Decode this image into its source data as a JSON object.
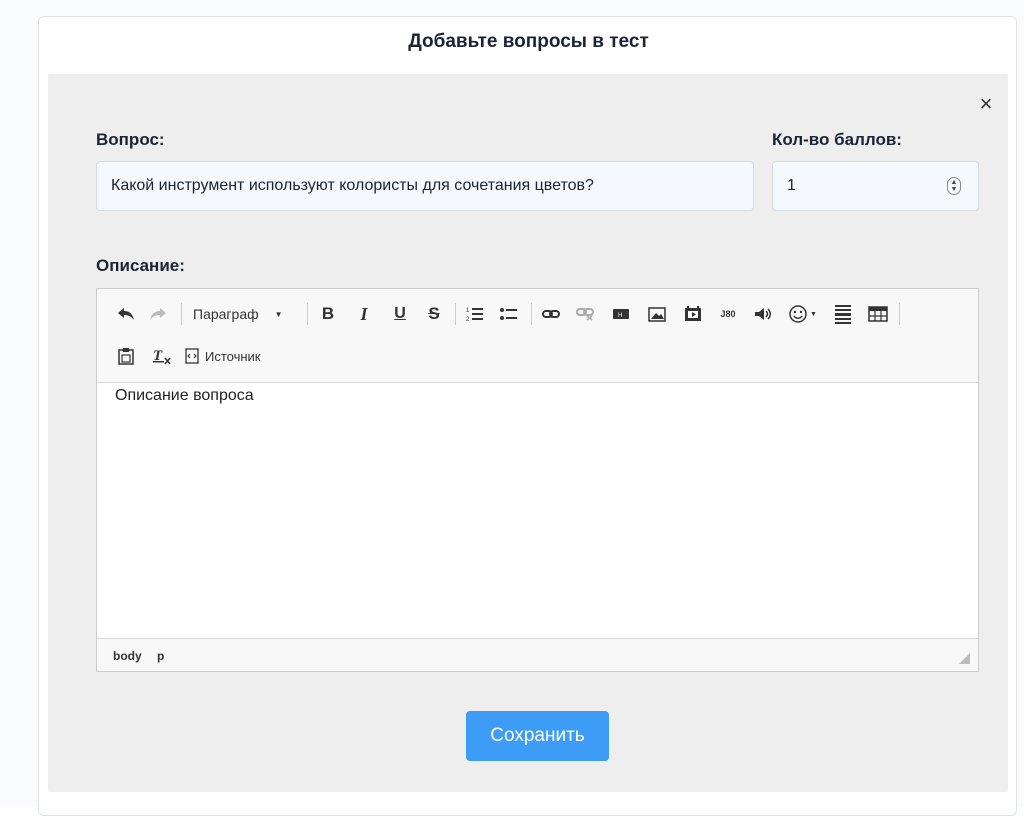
{
  "card": {
    "title": "Добавьте вопросы в тест"
  },
  "form": {
    "question_label": "Вопрос:",
    "question_value": "Какой инструмент используют колористы для сочетания цветов?",
    "points_label": "Кол-во баллов:",
    "points_value": "1",
    "description_label": "Описание:"
  },
  "editor": {
    "format_select": "Параграф",
    "source_label": "Источник",
    "content": "Описание вопроса",
    "path": [
      "body",
      "p"
    ],
    "toolbar_icons": [
      "undo-icon",
      "redo-icon",
      "bold-icon",
      "italic-icon",
      "underline-icon",
      "strikethrough-icon",
      "numbered-list-icon",
      "bulleted-list-icon",
      "link-icon",
      "unlink-icon",
      "anchor-icon",
      "image-icon",
      "media-icon",
      "iframe-icon",
      "audio-icon",
      "emoji-icon",
      "horizontal-rule-icon",
      "table-icon",
      "paste-icon",
      "clear-format-icon",
      "source-code-icon"
    ]
  },
  "actions": {
    "save_label": "Сохранить",
    "close_symbol": "×"
  }
}
